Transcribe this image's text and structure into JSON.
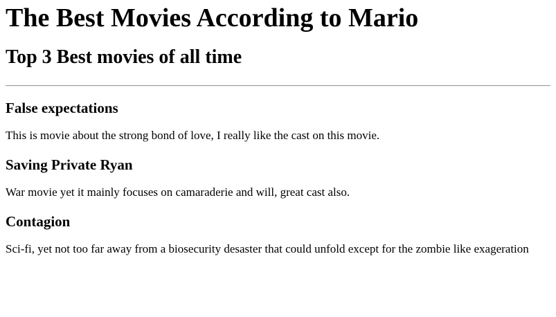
{
  "page": {
    "title": "The Best Movies According to Mario",
    "subtitle": "Top 3 Best movies of all time"
  },
  "movies": [
    {
      "title": "False expectations",
      "description": "This is movie about the strong bond of love, I really like the cast on this movie."
    },
    {
      "title": "Saving Private Ryan",
      "description": "War movie yet it mainly focuses on camaraderie and will, great cast also."
    },
    {
      "title": "Contagion",
      "description": "Sci-fi, yet not too far away from a biosecurity desaster that could unfold except for the zombie like exageration"
    }
  ]
}
